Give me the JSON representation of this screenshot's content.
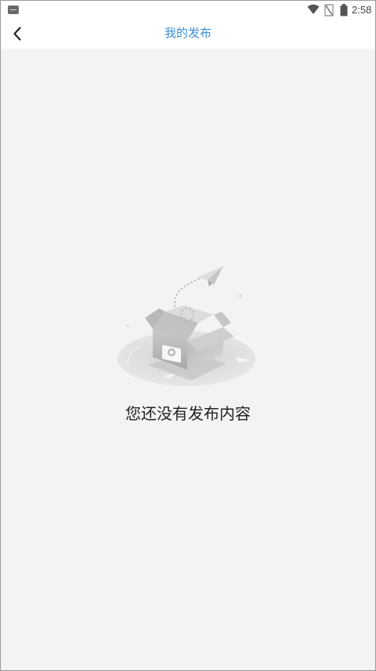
{
  "status_bar": {
    "time": "2:58",
    "icons": [
      "notification-icon",
      "wifi-icon",
      "no-signal-icon",
      "battery-icon"
    ]
  },
  "header": {
    "back_icon": "chevron-left-icon",
    "title": "我的发布",
    "title_color": "#3c8fd6"
  },
  "empty_state": {
    "illustration": "empty-box-with-paper-plane-icon",
    "message": "您还没有发布内容"
  },
  "colors": {
    "background": "#f3f3f3",
    "header_background": "#ffffff",
    "accent": "#3c8fd6"
  }
}
